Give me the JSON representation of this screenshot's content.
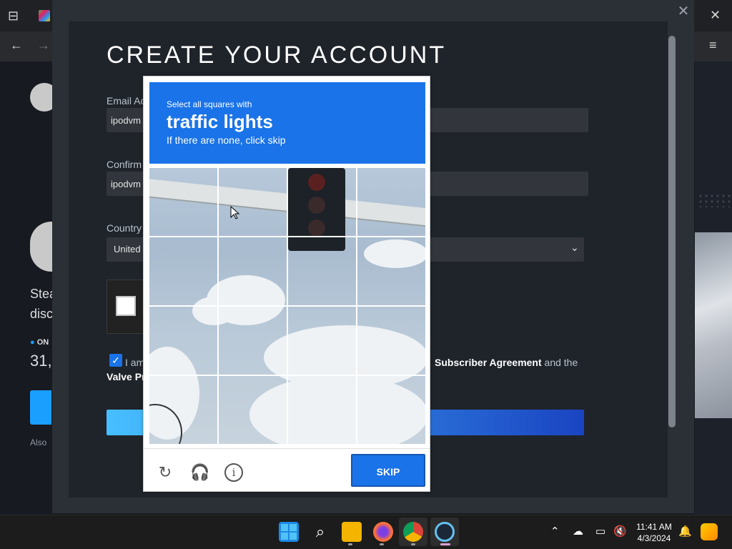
{
  "browser": {
    "tab_title": ""
  },
  "store": {
    "text_line1": "Stea",
    "text_line2": "disc",
    "online_label": "ON",
    "count": "31,",
    "also_text": "Also"
  },
  "modal": {
    "title": "CREATE YOUR ACCOUNT",
    "email_label": "Email Ac",
    "email_value": "ipodvm",
    "confirm_label": "Confirm",
    "confirm_value": "ipodvm",
    "country_label": "Country",
    "country_value": "United",
    "agree_text_left": "I am",
    "agree_text_right_bold": "Subscriber Agreement",
    "agree_text_right_tail": " and the",
    "valve_link": "Valve Pr"
  },
  "captcha": {
    "instruction_small": "Select all squares with",
    "target": "traffic lights",
    "hint": "If there are none, click skip",
    "skip_label": "SKIP"
  },
  "taskbar": {
    "time": "11:41 AM",
    "date": "4/3/2024"
  },
  "colors": {
    "captcha_blue": "#1a73e8",
    "steam_dark": "#1b1f27",
    "continue_gradient_start": "#47bfff",
    "continue_gradient_end": "#1a44c2"
  },
  "icons": [
    "tab-search-icon",
    "back-arrow-icon",
    "forward-arrow-icon",
    "close-icon",
    "menu-icon",
    "reload-icon",
    "headphones-icon",
    "info-icon",
    "windows-start-icon",
    "search-icon",
    "file-explorer-icon",
    "firefox-icon",
    "chrome-icon",
    "steam-icon",
    "chevron-up-icon",
    "network-icon",
    "notification-icon",
    "copilot-icon"
  ]
}
